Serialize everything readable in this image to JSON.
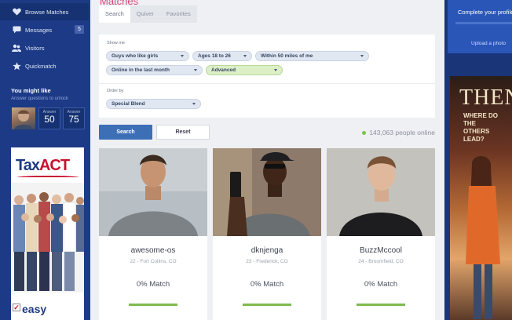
{
  "sidebar": {
    "nav": [
      {
        "label": "Browse Matches",
        "icon": "heart-icon"
      },
      {
        "label": "Messages",
        "icon": "chat-icon",
        "badge": "5"
      },
      {
        "label": "Visitors",
        "icon": "visitors-icon"
      },
      {
        "label": "Quickmatch",
        "icon": "star-icon"
      }
    ],
    "might_like": {
      "title": "You might like",
      "subtitle": "Answer questions to unlock",
      "answers": [
        {
          "label": "Answer",
          "value": "50"
        },
        {
          "label": "Answer",
          "value": "75"
        }
      ]
    },
    "ad": {
      "brand_main": "Tax",
      "brand_accent": "ACT",
      "check_mark": "✓",
      "slogan": "easy"
    }
  },
  "main": {
    "title": "Matches",
    "tabs": [
      "Search",
      "Quiver",
      "Favorites"
    ],
    "filters": {
      "show_me_label": "Show me",
      "pills": [
        "Guys who like girls",
        "Ages 18 to 26",
        "Within 50 miles of me",
        "Online in the last month",
        "Advanced"
      ],
      "order_by_label": "Order by",
      "order_by_value": "Special Blend"
    },
    "search_label": "Search",
    "reset_label": "Reset",
    "online_text": "143,063 people online",
    "cards": [
      {
        "name": "awesome-os",
        "location": "22 - Fort Collins, CO",
        "match": "0% Match"
      },
      {
        "name": "dknjenga",
        "location": "23 - Frederick, CO",
        "match": "0% Match"
      },
      {
        "name": "BuzzMccool",
        "location": "24 - Broomfield, CO",
        "match": "0% Match"
      }
    ]
  },
  "right": {
    "profile_text": "Complete your profile",
    "upload_text": "Upload a photo",
    "ad_title": "THEN",
    "ad_subtitle_1": "WHERE DO THE",
    "ad_subtitle_2": "OTHERS LEAD?"
  },
  "colors": {
    "sidebar": "#1c3a86",
    "accent_blue": "#3d6fb7",
    "match_green": "#7dbb4e",
    "title_pink": "#d64a7a"
  }
}
